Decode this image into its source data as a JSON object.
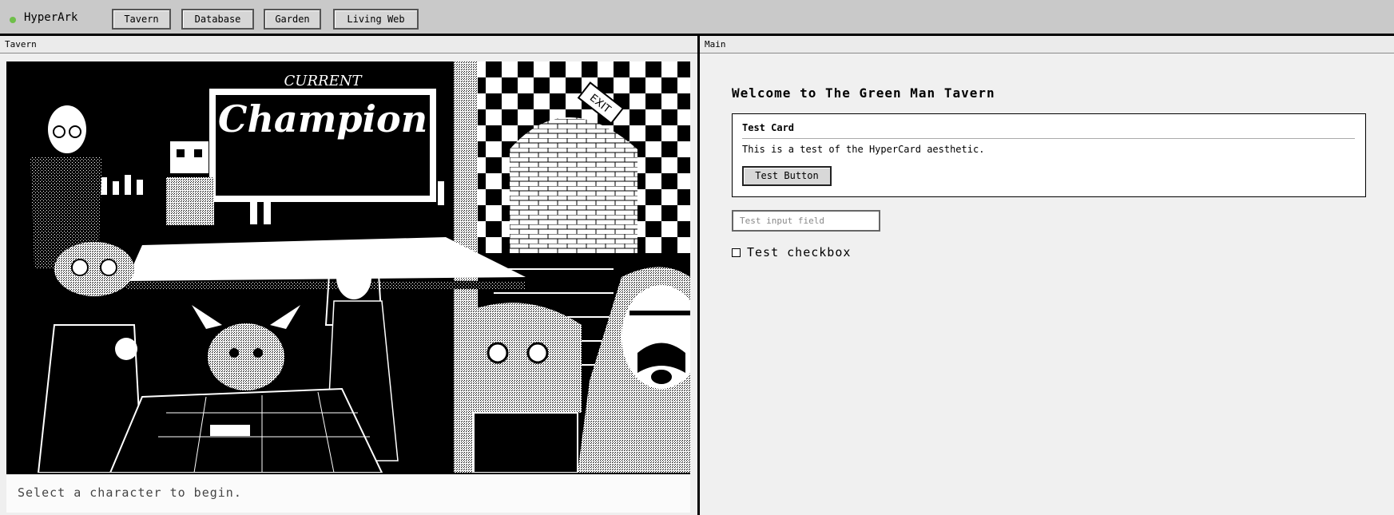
{
  "app": {
    "name": "HyperArk",
    "accent": "#6fbf4a"
  },
  "nav": [
    {
      "label": "Tavern"
    },
    {
      "label": "Database"
    },
    {
      "label": "Garden"
    },
    {
      "label": "Living Web"
    }
  ],
  "left_pane": {
    "title": "Tavern",
    "scene": {
      "sign_top": "CURRENT",
      "sign_main": "Champion",
      "exit_sign": "EXIT"
    },
    "status": "Select a character to begin."
  },
  "right_pane": {
    "title": "Main",
    "heading": "Welcome to The Green Man Tavern",
    "card": {
      "title": "Test Card",
      "text": "This is a test of the HyperCard aesthetic.",
      "button_label": "Test Button"
    },
    "input": {
      "placeholder": "Test input field",
      "value": ""
    },
    "checkbox": {
      "label": "Test checkbox",
      "checked": false
    }
  }
}
